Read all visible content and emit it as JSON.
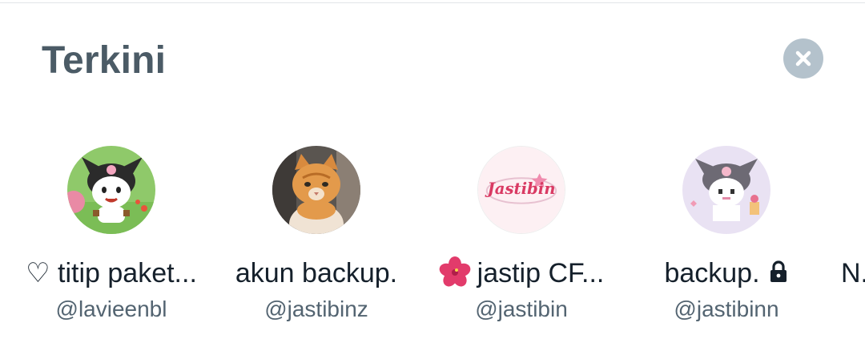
{
  "section": {
    "title": "Terkini",
    "close_icon": "close-icon"
  },
  "accounts": [
    {
      "name": "♡ titip paket...",
      "handle": "@lavieenbl",
      "avatar": "kuromi-cartoon-avatar"
    },
    {
      "name": "akun backup.",
      "handle": "@jastibinz",
      "avatar": "orange-cat-photo-avatar"
    },
    {
      "name": "jastip CF...",
      "name_prefix_icon": "hibiscus-emoji",
      "handle": "@jastibin",
      "avatar": "jastibin-logo-avatar",
      "logo_text": "Jastibin"
    },
    {
      "name": "backup.",
      "name_suffix_icon": "lock-icon",
      "handle": "@jastibinn",
      "avatar": "kuromi-pixel-avatar"
    }
  ],
  "partial_account": {
    "name": "N..."
  },
  "colors": {
    "title": "#4b5b66",
    "name": "#15202b",
    "handle": "#536471",
    "close_bg": "#b4c2cc"
  }
}
